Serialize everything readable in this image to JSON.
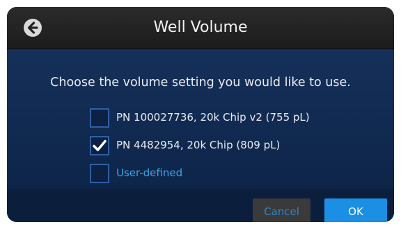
{
  "header": {
    "title": "Well Volume",
    "back_icon": "back-arrow-icon"
  },
  "prompt": "Choose the volume setting you would like to use.",
  "options": [
    {
      "label": "PN 100027736, 20k Chip v2 (755 pL)",
      "checked": false
    },
    {
      "label": "PN 4482954, 20k Chip (809 pL)",
      "checked": true
    },
    {
      "label": "User-defined",
      "checked": false
    }
  ],
  "buttons": {
    "cancel_label": "Cancel",
    "ok_label": "OK"
  },
  "colors": {
    "background": "#0f2748",
    "accent": "#1a8fe3",
    "link": "#3aa6e8",
    "checkbox_border": "#2f5fa3"
  }
}
